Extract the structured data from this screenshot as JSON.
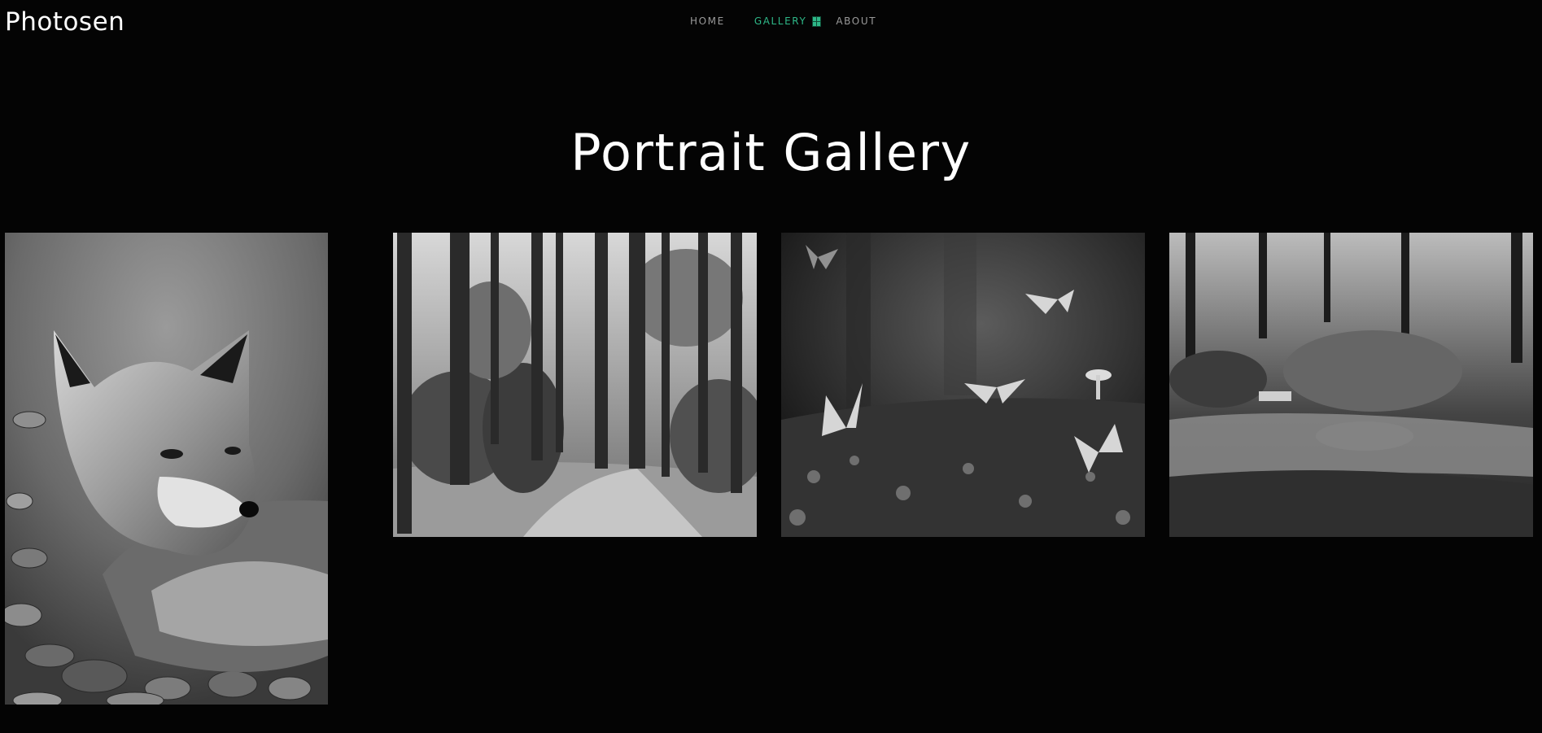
{
  "brand": {
    "name": "Photosen"
  },
  "nav": {
    "items": [
      {
        "label": "HOME",
        "active": false
      },
      {
        "label": "GALLERY",
        "active": true,
        "icon": "grid-icon"
      },
      {
        "label": "ABOUT",
        "active": false
      }
    ]
  },
  "main": {
    "title": "Portrait Gallery",
    "photos": [
      {
        "subject": "fox",
        "icon": "fox-photo"
      },
      {
        "subject": "forest",
        "icon": "forest-photo"
      },
      {
        "subject": "butterflies",
        "icon": "butterfly-photo"
      },
      {
        "subject": "stream",
        "icon": "stream-photo"
      }
    ]
  },
  "colors": {
    "background": "#040404",
    "accent": "#2eb888",
    "nav_text": "#9a9a9a",
    "text": "#ffffff"
  }
}
